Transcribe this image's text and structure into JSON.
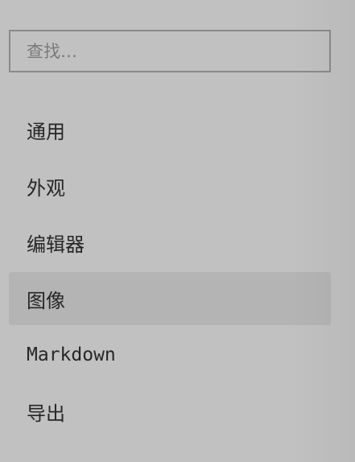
{
  "search": {
    "placeholder": "查找…"
  },
  "sidebar": {
    "items": [
      {
        "label": "通用",
        "active": false
      },
      {
        "label": "外观",
        "active": false
      },
      {
        "label": "编辑器",
        "active": false
      },
      {
        "label": "图像",
        "active": true
      },
      {
        "label": "Markdown",
        "active": false
      },
      {
        "label": "导出",
        "active": false
      }
    ]
  },
  "colors": {
    "background": "#c1c1c1",
    "active_item": "#b4b4b4",
    "search_border": "#8a8a8a",
    "text": "#262626"
  }
}
